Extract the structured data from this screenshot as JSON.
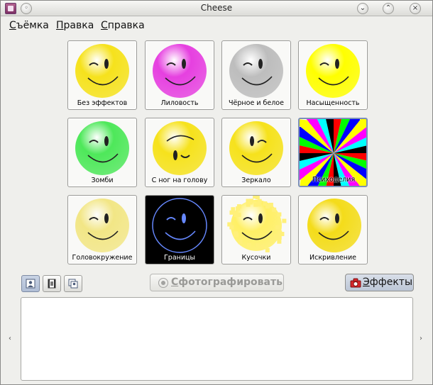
{
  "window": {
    "title": "Cheese"
  },
  "menu": [
    {
      "accel": "С",
      "rest": "ъёмка",
      "pre": ""
    },
    {
      "accel": "П",
      "rest": "равка",
      "pre": ""
    },
    {
      "accel": "С",
      "rest": "правка",
      "pre": ""
    }
  ],
  "effects": [
    {
      "id": "no-effect",
      "label": "Без эффектов",
      "color": "#f6e21c",
      "style": "normal"
    },
    {
      "id": "mauve",
      "label": "Лиловость",
      "color": "#e640e0",
      "style": "normal"
    },
    {
      "id": "noir",
      "label": "Чёрное и белое",
      "color": "#bdbdbd",
      "style": "normal"
    },
    {
      "id": "saturation",
      "label": "Насыщенность",
      "color": "#ffff00",
      "style": "bright"
    },
    {
      "id": "hulk",
      "label": "Зомби",
      "color": "#4ee85a",
      "style": "normal"
    },
    {
      "id": "vertical-flip",
      "label": "С ног на голову",
      "color": "#f6e21c",
      "style": "flip"
    },
    {
      "id": "horizontal-flip",
      "label": "Зеркало",
      "color": "#f6e21c",
      "style": "mirror"
    },
    {
      "id": "shagadelic",
      "label": "Психоделия",
      "color": "#ff0000",
      "style": "psy"
    },
    {
      "id": "vertigo",
      "label": "Головокружение",
      "color": "#f0e060",
      "style": "blur"
    },
    {
      "id": "edge",
      "label": "Границы",
      "color": "#000000",
      "style": "edge"
    },
    {
      "id": "dice",
      "label": "Кусочки",
      "color": "#fff066",
      "style": "dice"
    },
    {
      "id": "warp",
      "label": "Искривление",
      "color": "#f4dc1a",
      "style": "warp"
    }
  ],
  "selected_effect": "shagadelic",
  "toolbar": {
    "shoot_accel": "С",
    "shoot_rest": "фотографировать",
    "effects_accel": "Э",
    "effects_rest": "ффекты"
  },
  "icons": {
    "photo_mode": "photo-mode-icon",
    "video_mode": "video-mode-icon",
    "burst_mode": "burst-mode-icon",
    "effects": "effects-icon"
  }
}
